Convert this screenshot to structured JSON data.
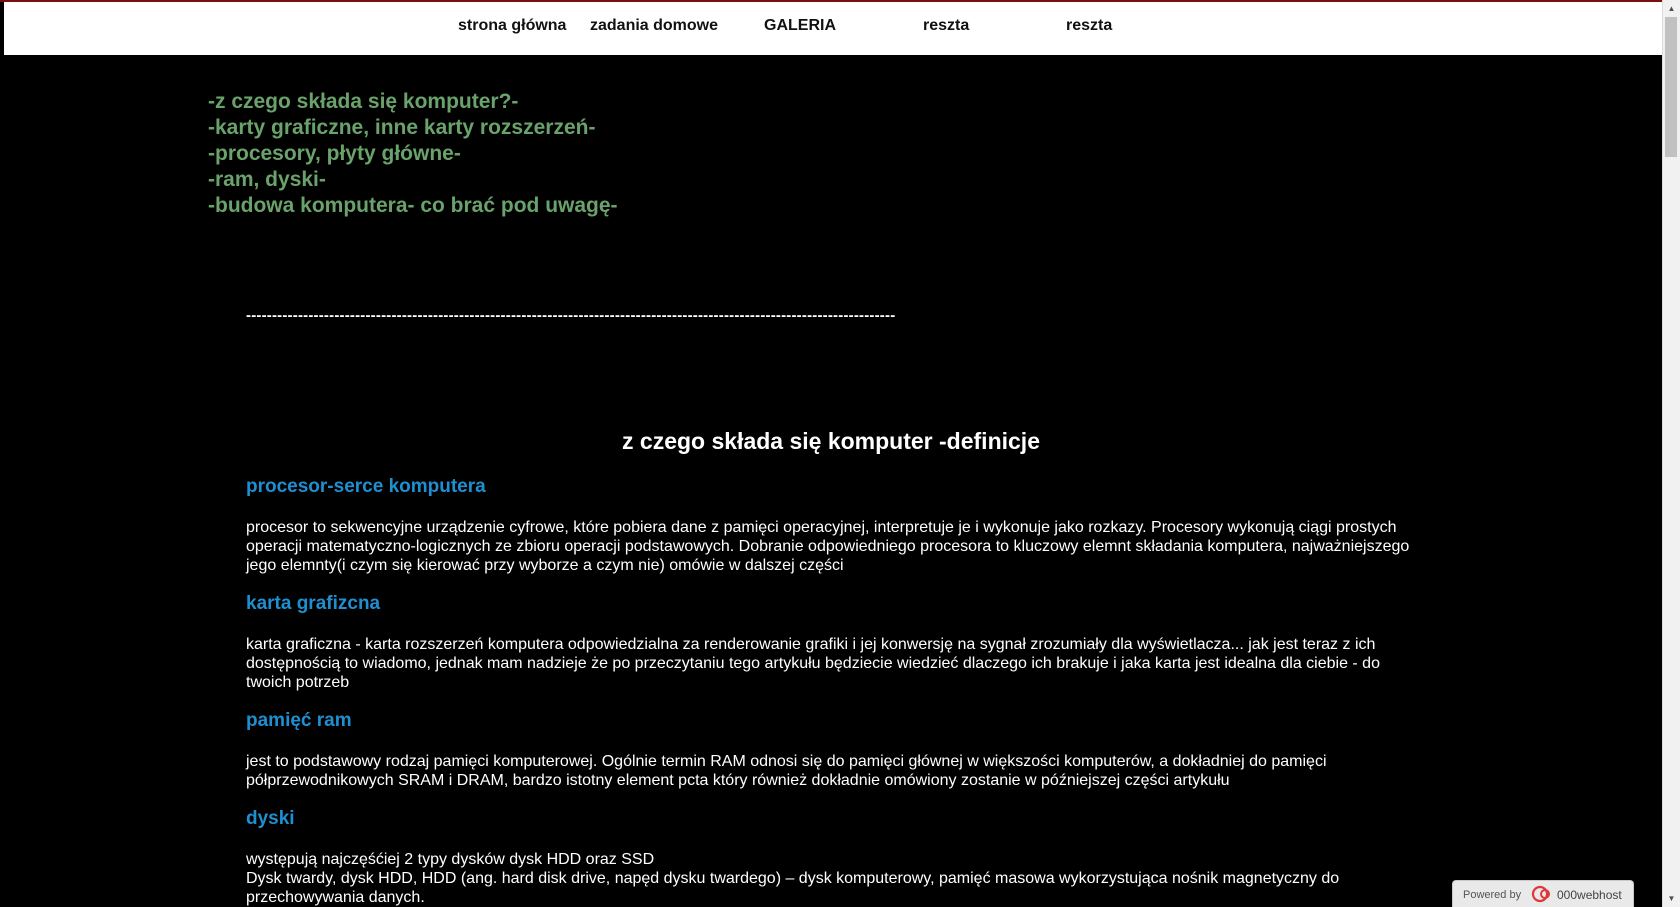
{
  "nav": {
    "items": [
      {
        "label": "strona główna"
      },
      {
        "label": "zadania domowe"
      },
      {
        "label": "GALERIA"
      },
      {
        "label": "reszta"
      },
      {
        "label": "reszta"
      }
    ]
  },
  "toc": [
    "-z czego składa się komputer?-",
    "-karty graficzne, inne karty rozszerzeń-",
    "-procesory, płyty główne-",
    "-ram, dyski-",
    "-budowa komputera- co brać pod uwagę-"
  ],
  "divider": "-----------------------------------------------------------------------------------------------------------------------------",
  "main_title": "z czego składa się komputer -definicje",
  "sections": [
    {
      "heading": "procesor-serce komputera",
      "text": "procesor to sekwencyjne urządzenie cyfrowe, które pobiera dane z pamięci operacyjnej, interpretuje je i wykonuje jako rozkazy. Procesory wykonują ciągi prostych operacji matematyczno-logicznych ze zbioru operacji podstawowych. Dobranie odpowiedniego procesora to kluczowy elemnt składania komputera, najważniejszego jego elemnty(i czym się kierować przy wyborze a czym nie) omówie w dalszej części"
    },
    {
      "heading": "karta grafizcna",
      "text": "karta graficzna - karta rozszerzeń komputera odpowiedzialna za renderowanie grafiki i jej konwersję na sygnał zrozumiały dla wyświetlacza... jak jest teraz z ich dostępnością to wiadomo, jednak mam nadzieje że po przeczytaniu tego artykułu będziecie wiedzieć dlaczego ich brakuje i jaka karta jest idealna dla ciebie - do twoich potrzeb"
    },
    {
      "heading": "pamięć ram",
      "text": "jest to podstawowy rodzaj pamięci komputerowej. Ogólnie termin RAM odnosi się do pamięci głównej w większości komputerów, a dokładniej do pamięci półprzewodnikowych SRAM i DRAM, bardzo istotny element pcta który również dokładnie omówiony zostanie w późniejszej części artykułu"
    },
    {
      "heading": "dyski",
      "line1": "występują najczęśćiej 2 typy dysków dysk HDD oraz SSD",
      "line2": "Dysk twardy, dysk HDD, HDD (ang. hard disk drive, napęd dysku twardego) – dysk komputerowy, pamięć masowa wykorzystująca nośnik magnetyczny do przechowywania danych."
    }
  ],
  "badge": {
    "powered": "Powered by",
    "host": "000webhost"
  },
  "colors": {
    "toc": "#6aa26b",
    "section_heading": "#1e8fd1",
    "background": "#000000",
    "nav_bg": "#ffffff"
  }
}
